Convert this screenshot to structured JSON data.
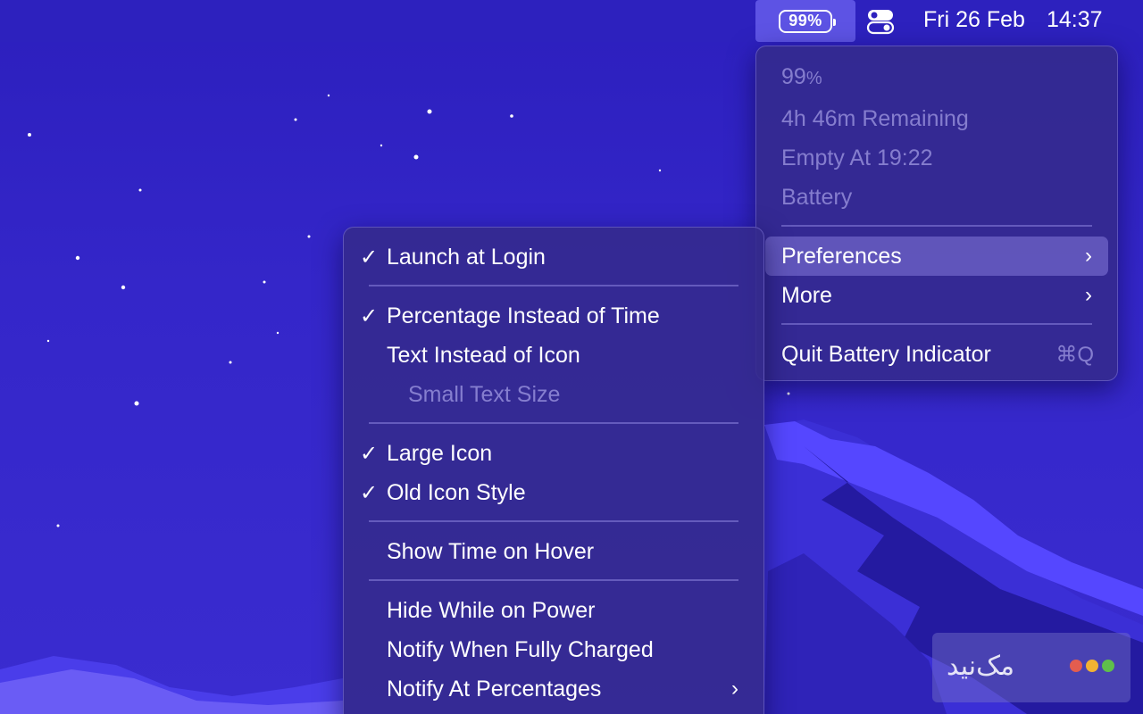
{
  "menubar": {
    "battery_percent": "99%",
    "date": "Fri 26 Feb",
    "time": "14:37"
  },
  "main_menu": {
    "percent_value": "99",
    "percent_unit": "%",
    "remaining": "4h 46m Remaining",
    "empty_at": "Empty At 19:22",
    "source": "Battery",
    "preferences": "Preferences",
    "more": "More",
    "quit": "Quit Battery Indicator",
    "quit_shortcut": "⌘Q"
  },
  "preferences_menu": {
    "launch_at_login": "Launch at Login",
    "percentage_instead_of_time": "Percentage Instead of Time",
    "text_instead_of_icon": "Text Instead of Icon",
    "small_text_size": "Small Text Size",
    "large_icon": "Large Icon",
    "old_icon_style": "Old Icon Style",
    "show_time_on_hover": "Show Time on Hover",
    "hide_while_on_power": "Hide While on Power",
    "notify_when_fully_charged": "Notify When Fully Charged",
    "notify_at_percentages": "Notify At Percentages",
    "check_mark": "✓"
  },
  "watermark": {
    "text": "مک‌نید"
  },
  "colors": {
    "wallpaper_top": "#2c1fbd",
    "wallpaper_mountain": "#4a3cf0",
    "menu_bg": "#342a8c",
    "highlight": "#9690eb",
    "watermark_dots": [
      "#e35d4f",
      "#f2b233",
      "#5fbf4b"
    ]
  }
}
